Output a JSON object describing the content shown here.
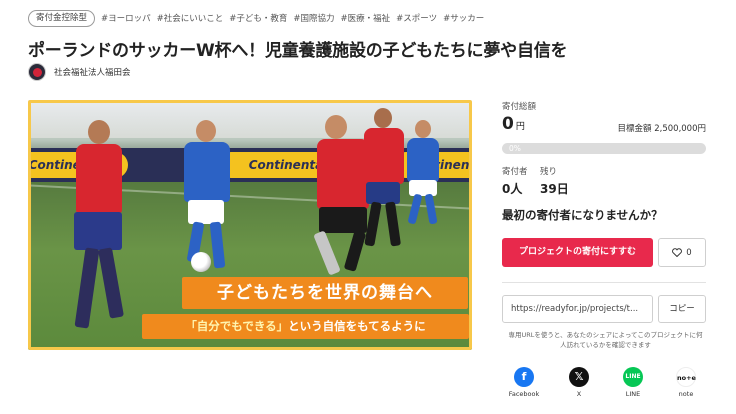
{
  "tags": {
    "badge": "寄付金控除型",
    "items": [
      "#ヨーロッパ",
      "#社会にいいこと",
      "#子ども・教育",
      "#国際協力",
      "#医療・福祉",
      "#スポーツ",
      "#サッカー"
    ]
  },
  "project": {
    "title": "ポーランドのサッカーW杯へ！児童養護施設の子どもたちに夢や自信を",
    "organization": "社会福祉法人福田会"
  },
  "hero": {
    "ad_text": "Continental",
    "caption_main": "子どもたちを世界の舞台へ",
    "caption_sub_highlight": "「自分でもできる」",
    "caption_sub_rest": "という自信をもてるように"
  },
  "funding": {
    "total_label": "寄付総額",
    "amount": "0",
    "amount_unit": "円",
    "target_text": "目標金額 2,500,000円",
    "progress_percent": 0,
    "progress_text": "0%",
    "donors_label": "寄付者",
    "donors_value": "0人",
    "remaining_label": "残り",
    "remaining_value": "39日",
    "first_prompt": "最初の寄付者になりませんか？",
    "cta_label": "プロジェクトの寄付にすすむ",
    "favorite_count": "0"
  },
  "share": {
    "url": "https://readyfor.jp/projects/t...",
    "copy_label": "コピー",
    "note": "専用URLを使うと、あなたのシェアによってこのプロジェクトに何人訪れているかを確認できます",
    "buttons": [
      {
        "label": "Facebook",
        "icon": "facebook-icon",
        "color": "#1877f2"
      },
      {
        "label": "X",
        "icon": "x-icon",
        "color": "#111111"
      },
      {
        "label": "LINE",
        "icon": "line-icon",
        "color": "#06c755"
      },
      {
        "label": "note",
        "icon": "note-icon",
        "color": "#111111"
      }
    ]
  },
  "colors": {
    "accent": "#e8294c",
    "progress": "#2fa36b",
    "caption_bg": "#f08a1d"
  }
}
